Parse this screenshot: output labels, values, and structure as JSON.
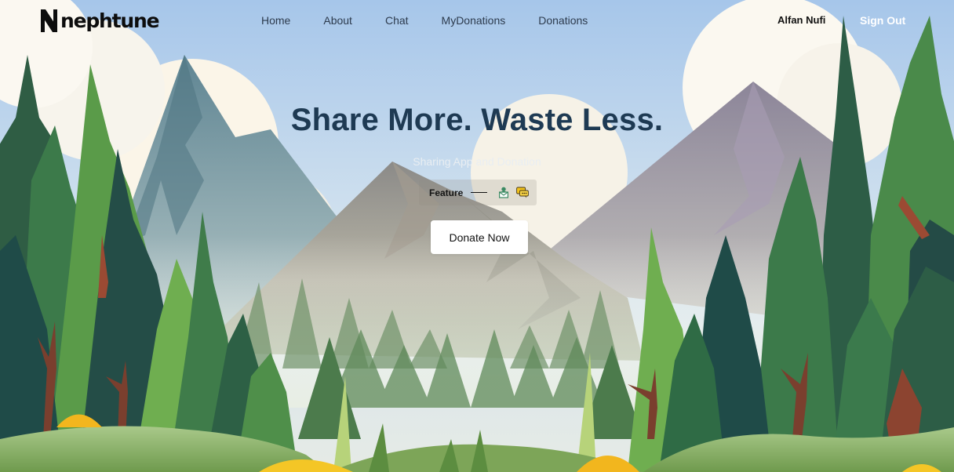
{
  "brand": {
    "name": "nephtune",
    "icon": "n-logo-icon"
  },
  "nav": {
    "items": [
      {
        "label": "Home"
      },
      {
        "label": "About"
      },
      {
        "label": "Chat"
      },
      {
        "label": "MyDonations"
      },
      {
        "label": "Donations"
      }
    ]
  },
  "user": {
    "name": "Alfan Nufi",
    "signout_label": "Sign Out"
  },
  "hero": {
    "title": "Share More. Waste Less.",
    "subtitle": "Sharing App and Donation",
    "feature_label": "Feature",
    "feature_icons": [
      "donation-box-icon",
      "chat-bubble-icon"
    ],
    "cta_label": "Donate Now"
  },
  "colors": {
    "title": "#1e3a53",
    "sky": "#a9c9ea",
    "cta_bg": "#ffffff",
    "signout": "#ffffff"
  }
}
